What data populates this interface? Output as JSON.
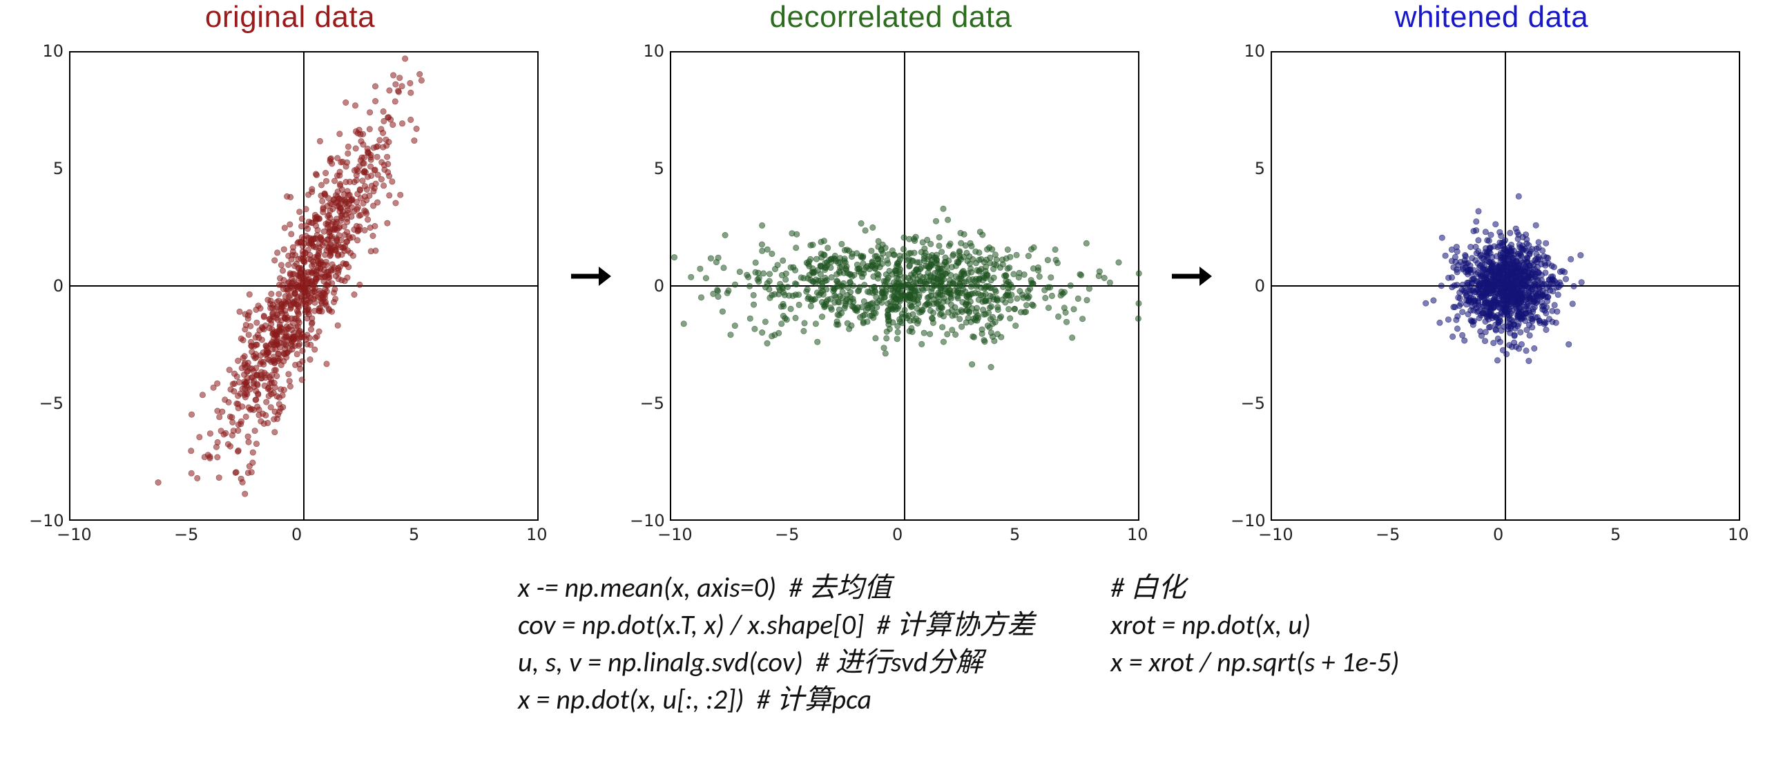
{
  "chart_data": [
    {
      "type": "scatter",
      "title": "original data",
      "title_color": "#9a1b1b",
      "point_color": "#8a1c1c",
      "xlim": [
        -10,
        10
      ],
      "ylim": [
        -10,
        10
      ],
      "xticks": [
        -10,
        -5,
        0,
        5,
        10
      ],
      "yticks": [
        -10,
        -5,
        0,
        5,
        10
      ],
      "distribution": "correlated",
      "n_points": 1000,
      "cov": [
        [
          3.2,
          5.5
        ],
        [
          5.5,
          12.0
        ]
      ],
      "mean": [
        0,
        0
      ]
    },
    {
      "type": "scatter",
      "title": "decorrelated data",
      "title_color": "#2d6b1f",
      "point_color": "#1f5420",
      "xlim": [
        -10,
        10
      ],
      "ylim": [
        -10,
        10
      ],
      "xticks": [
        -10,
        -5,
        0,
        5,
        10
      ],
      "yticks": [
        -10,
        -5,
        0,
        5,
        10
      ],
      "distribution": "decorrelated",
      "n_points": 1000,
      "cov": [
        [
          12.0,
          0
        ],
        [
          0,
          1.0
        ]
      ],
      "mean": [
        0,
        0
      ]
    },
    {
      "type": "scatter",
      "title": "whitened data",
      "title_color": "#1818c9",
      "point_color": "#141478",
      "xlim": [
        -10,
        10
      ],
      "ylim": [
        -10,
        10
      ],
      "xticks": [
        -10,
        -5,
        0,
        5,
        10
      ],
      "yticks": [
        -10,
        -5,
        0,
        5,
        10
      ],
      "distribution": "whitened",
      "n_points": 1000,
      "cov": [
        [
          1.0,
          0
        ],
        [
          0,
          1.0
        ]
      ],
      "mean": [
        0,
        0
      ]
    }
  ],
  "code": {
    "left": "x -= np.mean(x, axis=0)  # 去均值\ncov = np.dot(x.T, x) / x.shape[0]  # 计算协方差\nu, s, v = np.linalg.svd(cov)  # 进行svd分解\nx = np.dot(x, u[:, :2])  # 计算pca",
    "right": "# 白化\nxrot = np.dot(x, u)\nx = xrot / np.sqrt(s + 1e-5)"
  },
  "layout": {
    "plot_inner_w": 680,
    "plot_inner_h": 680,
    "plot_left_pad": 70,
    "plot_top_pad": 20,
    "plot_bot_pad": 50,
    "plot_right_pad": 30
  }
}
